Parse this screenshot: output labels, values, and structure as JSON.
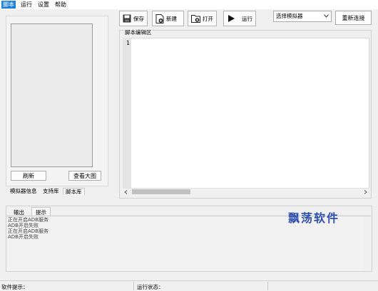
{
  "menubar": {
    "items": [
      "脚本",
      "运行",
      "设置",
      "帮助"
    ]
  },
  "left_panel": {
    "refresh_label": "刷新",
    "view_large_label": "查看大图",
    "tabs": [
      "模拟器信息",
      "支持库",
      "脚本库"
    ]
  },
  "toolbar": {
    "save_label": "保存",
    "new_label": "新建",
    "open_label": "打开",
    "run_label": "运行",
    "emulator_select": "选择模拟器",
    "reconnect_label": "重新连接"
  },
  "editor": {
    "label": "脚本编辑区",
    "line_number": "1"
  },
  "bottom": {
    "tabs": [
      "输出",
      "提示"
    ],
    "log": [
      "正在开启ADB服务",
      "ADB开启失败",
      "正在开启ADB服务",
      "ADB开启失败"
    ],
    "watermark": "飘荡软件"
  },
  "statusbar": {
    "hint_label": "软件提示：",
    "run_status_label": "运行状态："
  }
}
